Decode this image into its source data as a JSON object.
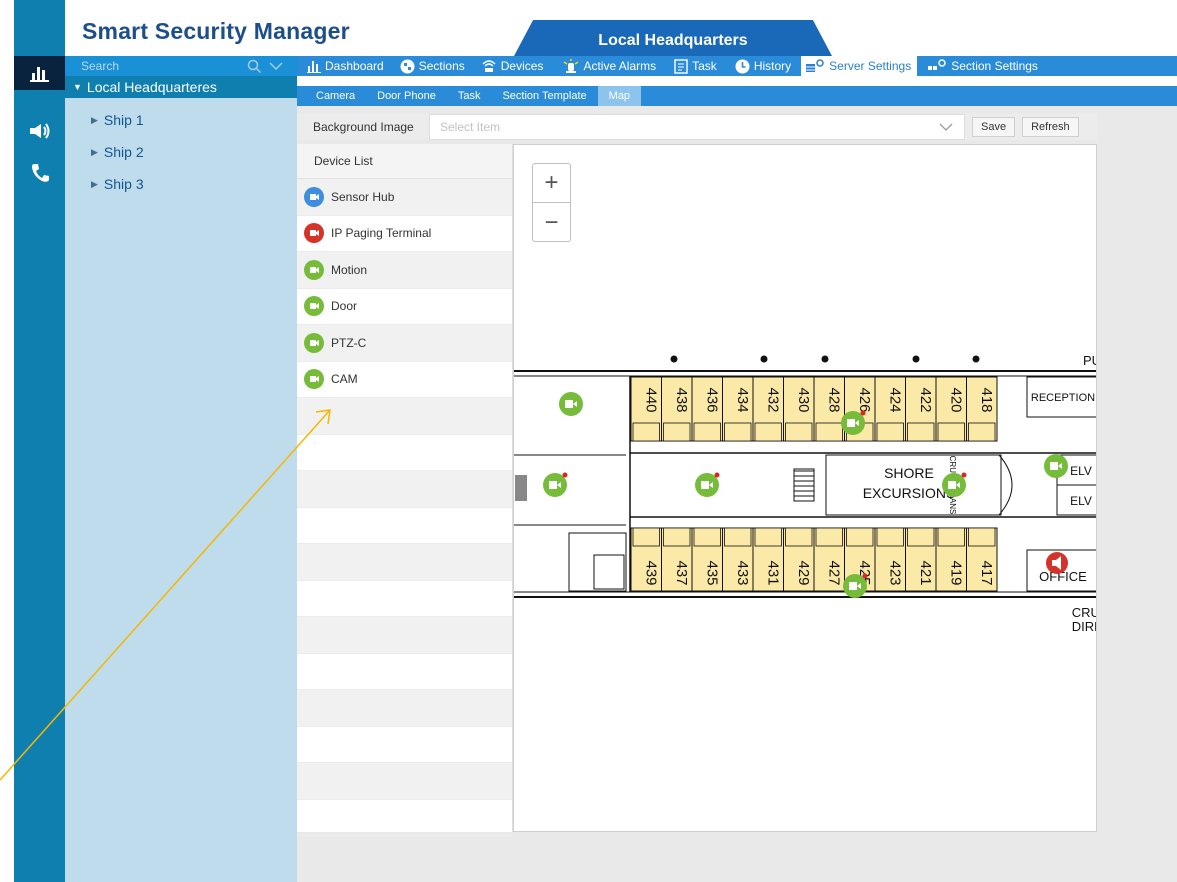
{
  "app": {
    "title": "Smart Security Manager",
    "header_tab": "Local Headquarters"
  },
  "search": {
    "placeholder": "Search"
  },
  "tree": {
    "root": "Local Headquarteres",
    "children": [
      "Ship 1",
      "Ship 2",
      "Ship 3"
    ]
  },
  "main_menu": [
    {
      "label": "Dashboard",
      "icon": "bar-chart-icon"
    },
    {
      "label": "Sections",
      "icon": "sections-icon"
    },
    {
      "label": "Devices",
      "icon": "devices-icon"
    },
    {
      "label": "Active Alarms",
      "icon": "alarm-icon"
    },
    {
      "label": "Task",
      "icon": "task-icon"
    },
    {
      "label": "History",
      "icon": "clock-icon"
    },
    {
      "label": "Server Settings",
      "icon": "server-settings-icon"
    },
    {
      "label": "Section Settings",
      "icon": "section-settings-icon"
    }
  ],
  "sub_tabs": [
    "Camera",
    "Door Phone",
    "Task",
    "Section Template",
    "Map"
  ],
  "background_image": {
    "label": "Background Image",
    "placeholder": "Select Item",
    "save": "Save",
    "refresh": "Refresh"
  },
  "device_list": {
    "header": "Device List",
    "items": [
      {
        "label": "Sensor Hub",
        "icon": "sensor-hub-icon",
        "color": "#3d8ee0"
      },
      {
        "label": "IP Paging Terminal",
        "icon": "speaker-icon",
        "color": "#d5322a"
      },
      {
        "label": "Motion",
        "icon": "motion-icon",
        "color": "#76bb3a"
      },
      {
        "label": "Door",
        "icon": "door-icon",
        "color": "#76bb3a"
      },
      {
        "label": "PTZ-C",
        "icon": "ptz-camera-icon",
        "color": "#76bb3a"
      },
      {
        "label": "CAM",
        "icon": "camera-icon",
        "color": "#76bb3a"
      }
    ]
  },
  "map": {
    "top_cabins": [
      "440",
      "438",
      "436",
      "434",
      "432",
      "430",
      "428",
      "426",
      "424",
      "422",
      "420",
      "418"
    ],
    "bottom_cabins": [
      "439",
      "437",
      "435",
      "433",
      "431",
      "429",
      "427",
      "425",
      "423",
      "421",
      "419",
      "417"
    ],
    "labels": {
      "reception": "RECEPTION",
      "shore": "SHORE",
      "excursions": "EXCURSIONS",
      "office": "OFFICE",
      "elv": "ELV",
      "pu": "PU",
      "cruis": "CRUIS",
      "direc": "DIREC",
      "cruise_plans": "CRUISE PLANS"
    },
    "zoom_in": "+",
    "zoom_out": "−"
  },
  "colors": {
    "rail": "#0f7fb0",
    "menu": "#2a8bd8",
    "tree_bg": "#bedcec",
    "cabin": "#fbe9a8",
    "cam": "#76bb3a",
    "paging": "#d5322a",
    "annotation": "#f5b800"
  }
}
